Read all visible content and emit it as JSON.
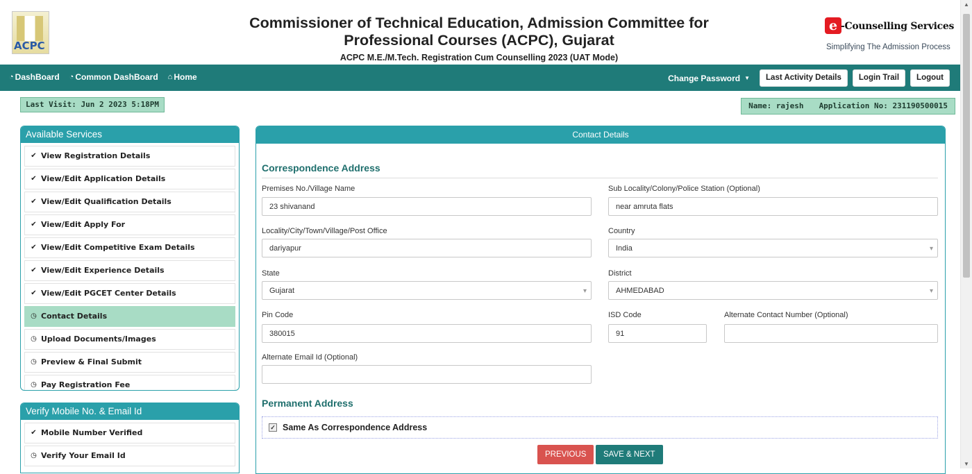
{
  "header": {
    "logo_text": "ACPC",
    "title_line1": "Commissioner of Technical Education, Admission Committee for",
    "title_line2": "Professional Courses (ACPC), Gujarat",
    "subtitle": "ACPC M.E./M.Tech. Registration Cum Counselling 2023 (UAT Mode)",
    "ecs_badge": "e",
    "ecs_name": "-Counselling Services",
    "ecs_tagline": "Simplifying The Admission Process"
  },
  "nav": {
    "dashboard": "DashBoard",
    "common_dashboard": "Common DashBoard",
    "home": "Home",
    "change_password": "Change Password",
    "last_activity": "Last Activity Details",
    "login_trail": "Login Trail",
    "logout": "Logout"
  },
  "info": {
    "last_visit": "Last Visit: Jun 2 2023 5:18PM",
    "name": "Name: rajesh",
    "application_no": "Application No: 231190500015"
  },
  "services": {
    "title": "Available Services",
    "items": [
      {
        "label": "View Registration Details",
        "icon": "✔"
      },
      {
        "label": "View/Edit Application Details",
        "icon": "✔"
      },
      {
        "label": "View/Edit Qualification Details",
        "icon": "✔"
      },
      {
        "label": "View/Edit Apply For",
        "icon": "✔"
      },
      {
        "label": "View/Edit Competitive Exam Details",
        "icon": "✔"
      },
      {
        "label": "View/Edit Experience Details",
        "icon": "✔"
      },
      {
        "label": "View/Edit PGCET Center Details",
        "icon": "✔"
      },
      {
        "label": "Contact Details",
        "icon": "◷"
      },
      {
        "label": "Upload Documents/Images",
        "icon": "◷"
      },
      {
        "label": "Preview & Final Submit",
        "icon": "◷"
      },
      {
        "label": "Pay Registration Fee",
        "icon": "◷"
      }
    ]
  },
  "verify": {
    "title": "Verify Mobile No. & Email Id",
    "items": [
      {
        "label": "Mobile Number Verified",
        "icon": "✔"
      },
      {
        "label": "Verify Your Email Id",
        "icon": "◷"
      }
    ]
  },
  "contact": {
    "title": "Contact Details",
    "correspondence_title": "Correspondence Address",
    "premises_label": "Premises No./Village Name",
    "premises_value": "23 shivanand",
    "sublocality_label": "Sub Locality/Colony/Police Station (Optional)",
    "sublocality_value": "near amruta flats",
    "locality_label": "Locality/City/Town/Village/Post Office",
    "locality_value": "dariyapur",
    "country_label": "Country",
    "country_value": "India",
    "state_label": "State",
    "state_value": "Gujarat",
    "district_label": "District",
    "district_value": "AHMEDABAD",
    "pincode_label": "Pin Code",
    "pincode_value": "380015",
    "isd_label": "ISD Code",
    "isd_value": "91",
    "altcontact_label": "Alternate Contact Number (Optional)",
    "altcontact_value": "",
    "altemail_label": "Alternate Email Id (Optional)",
    "altemail_value": "",
    "permanent_title": "Permanent Address",
    "same_as_label": "Same As Correspondence Address",
    "previous_btn": "PREVIOUS",
    "save_next_btn": "SAVE & NEXT"
  },
  "colors": {
    "nav": "#1f7b79",
    "panel": "#2aa0aa",
    "highlight": "#a8dcc5",
    "previous": "#d9534f"
  }
}
